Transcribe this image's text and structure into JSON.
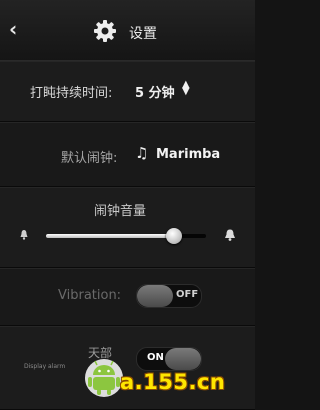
{
  "header": {
    "back_icon": "chevron-left-icon",
    "settings_icon": "gear-icon",
    "title": "设置"
  },
  "duration": {
    "label": "打盹持续时间:",
    "value": "5 分钟",
    "icon": "up-down-arrows-icon"
  },
  "default_alarm": {
    "label": "默认闹钟:",
    "icon": "music-note-icon",
    "value": "Marimba"
  },
  "volume": {
    "label": "闹钟音量",
    "level": 0.8,
    "min_icon": "bell-small-icon",
    "max_icon": "bell-large-icon"
  },
  "vibration": {
    "label": "Vibration:",
    "state": "OFF"
  },
  "display": {
    "label_small": "Display alarm",
    "label_partial": "天部",
    "state": "ON"
  },
  "watermark": {
    "icon": "android-robot-icon",
    "text": "a.155.cn"
  },
  "colors": {
    "background": "#141414",
    "watermark_yellow": "#ffe600"
  }
}
